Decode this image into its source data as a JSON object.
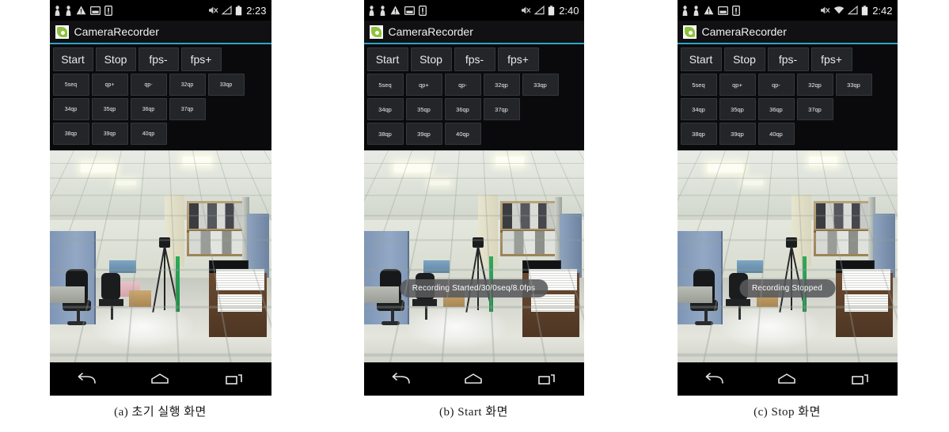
{
  "figure": {
    "panels": [
      {
        "caption": "(a) 초기 실행 화면",
        "status": {
          "time": "2:23",
          "left_icons": [
            "person-icon",
            "person-icon",
            "warning-triangle-icon",
            "screenshot-icon",
            "sim-card-icon"
          ],
          "right_icons": [
            "mute-icon",
            "signal-icon",
            "battery-icon"
          ],
          "wifi": false
        },
        "app": {
          "title": "CameraRecorder",
          "icon": "android-app-icon"
        },
        "buttons_main": [
          "Start",
          "Stop",
          "fps-",
          "fps+"
        ],
        "buttons_rows": [
          [
            "5seq",
            "qp+",
            "qp-",
            "32qp",
            "33qp"
          ],
          [
            "34qp",
            "35qp",
            "36qp",
            "37qp"
          ],
          [
            "38qp",
            "39qp",
            "40qp"
          ]
        ],
        "toast": "",
        "nav": [
          "back-icon",
          "home-icon",
          "recents-icon"
        ]
      },
      {
        "caption": "(b) Start 화면",
        "status": {
          "time": "2:40",
          "left_icons": [
            "person-icon",
            "person-icon",
            "warning-triangle-icon",
            "screenshot-icon",
            "sim-card-icon"
          ],
          "right_icons": [
            "mute-icon",
            "signal-icon",
            "battery-icon"
          ],
          "wifi": false
        },
        "app": {
          "title": "CameraRecorder",
          "icon": "android-app-icon"
        },
        "buttons_main": [
          "Start",
          "Stop",
          "fps-",
          "fps+"
        ],
        "buttons_rows": [
          [
            "5seq",
            "qp+",
            "qp-",
            "32qp",
            "33qp"
          ],
          [
            "34qp",
            "35qp",
            "36qp",
            "37qp"
          ],
          [
            "38qp",
            "39qp",
            "40qp"
          ]
        ],
        "toast": "Recording Started/30/0seq/8.0fps",
        "nav": [
          "back-icon",
          "home-icon",
          "recents-icon"
        ]
      },
      {
        "caption": "(c) Stop 화면",
        "status": {
          "time": "2:42",
          "left_icons": [
            "person-icon",
            "person-icon",
            "warning-triangle-icon",
            "screenshot-icon",
            "sim-card-icon"
          ],
          "right_icons": [
            "mute-icon",
            "wifi-icon",
            "signal-icon",
            "battery-icon"
          ],
          "wifi": true
        },
        "app": {
          "title": "CameraRecorder",
          "icon": "android-app-icon"
        },
        "buttons_main": [
          "Start",
          "Stop",
          "fps-",
          "fps+"
        ],
        "buttons_rows": [
          [
            "5seq",
            "qp+",
            "qp-",
            "32qp",
            "33qp"
          ],
          [
            "34qp",
            "35qp",
            "36qp",
            "37qp"
          ],
          [
            "38qp",
            "39qp",
            "40qp"
          ]
        ],
        "toast": "Recording Stopped",
        "nav": [
          "back-icon",
          "home-icon",
          "recents-icon"
        ]
      }
    ],
    "colors": {
      "accent": "#2ea3cc",
      "statusbar_bg": "#000000",
      "actionbar_bg": "#111113",
      "button_bg": "#232528",
      "panel_bg": "#0a0a0c",
      "toast_bg": "#585a5c",
      "app_icon_green": "#8fc23e"
    }
  }
}
